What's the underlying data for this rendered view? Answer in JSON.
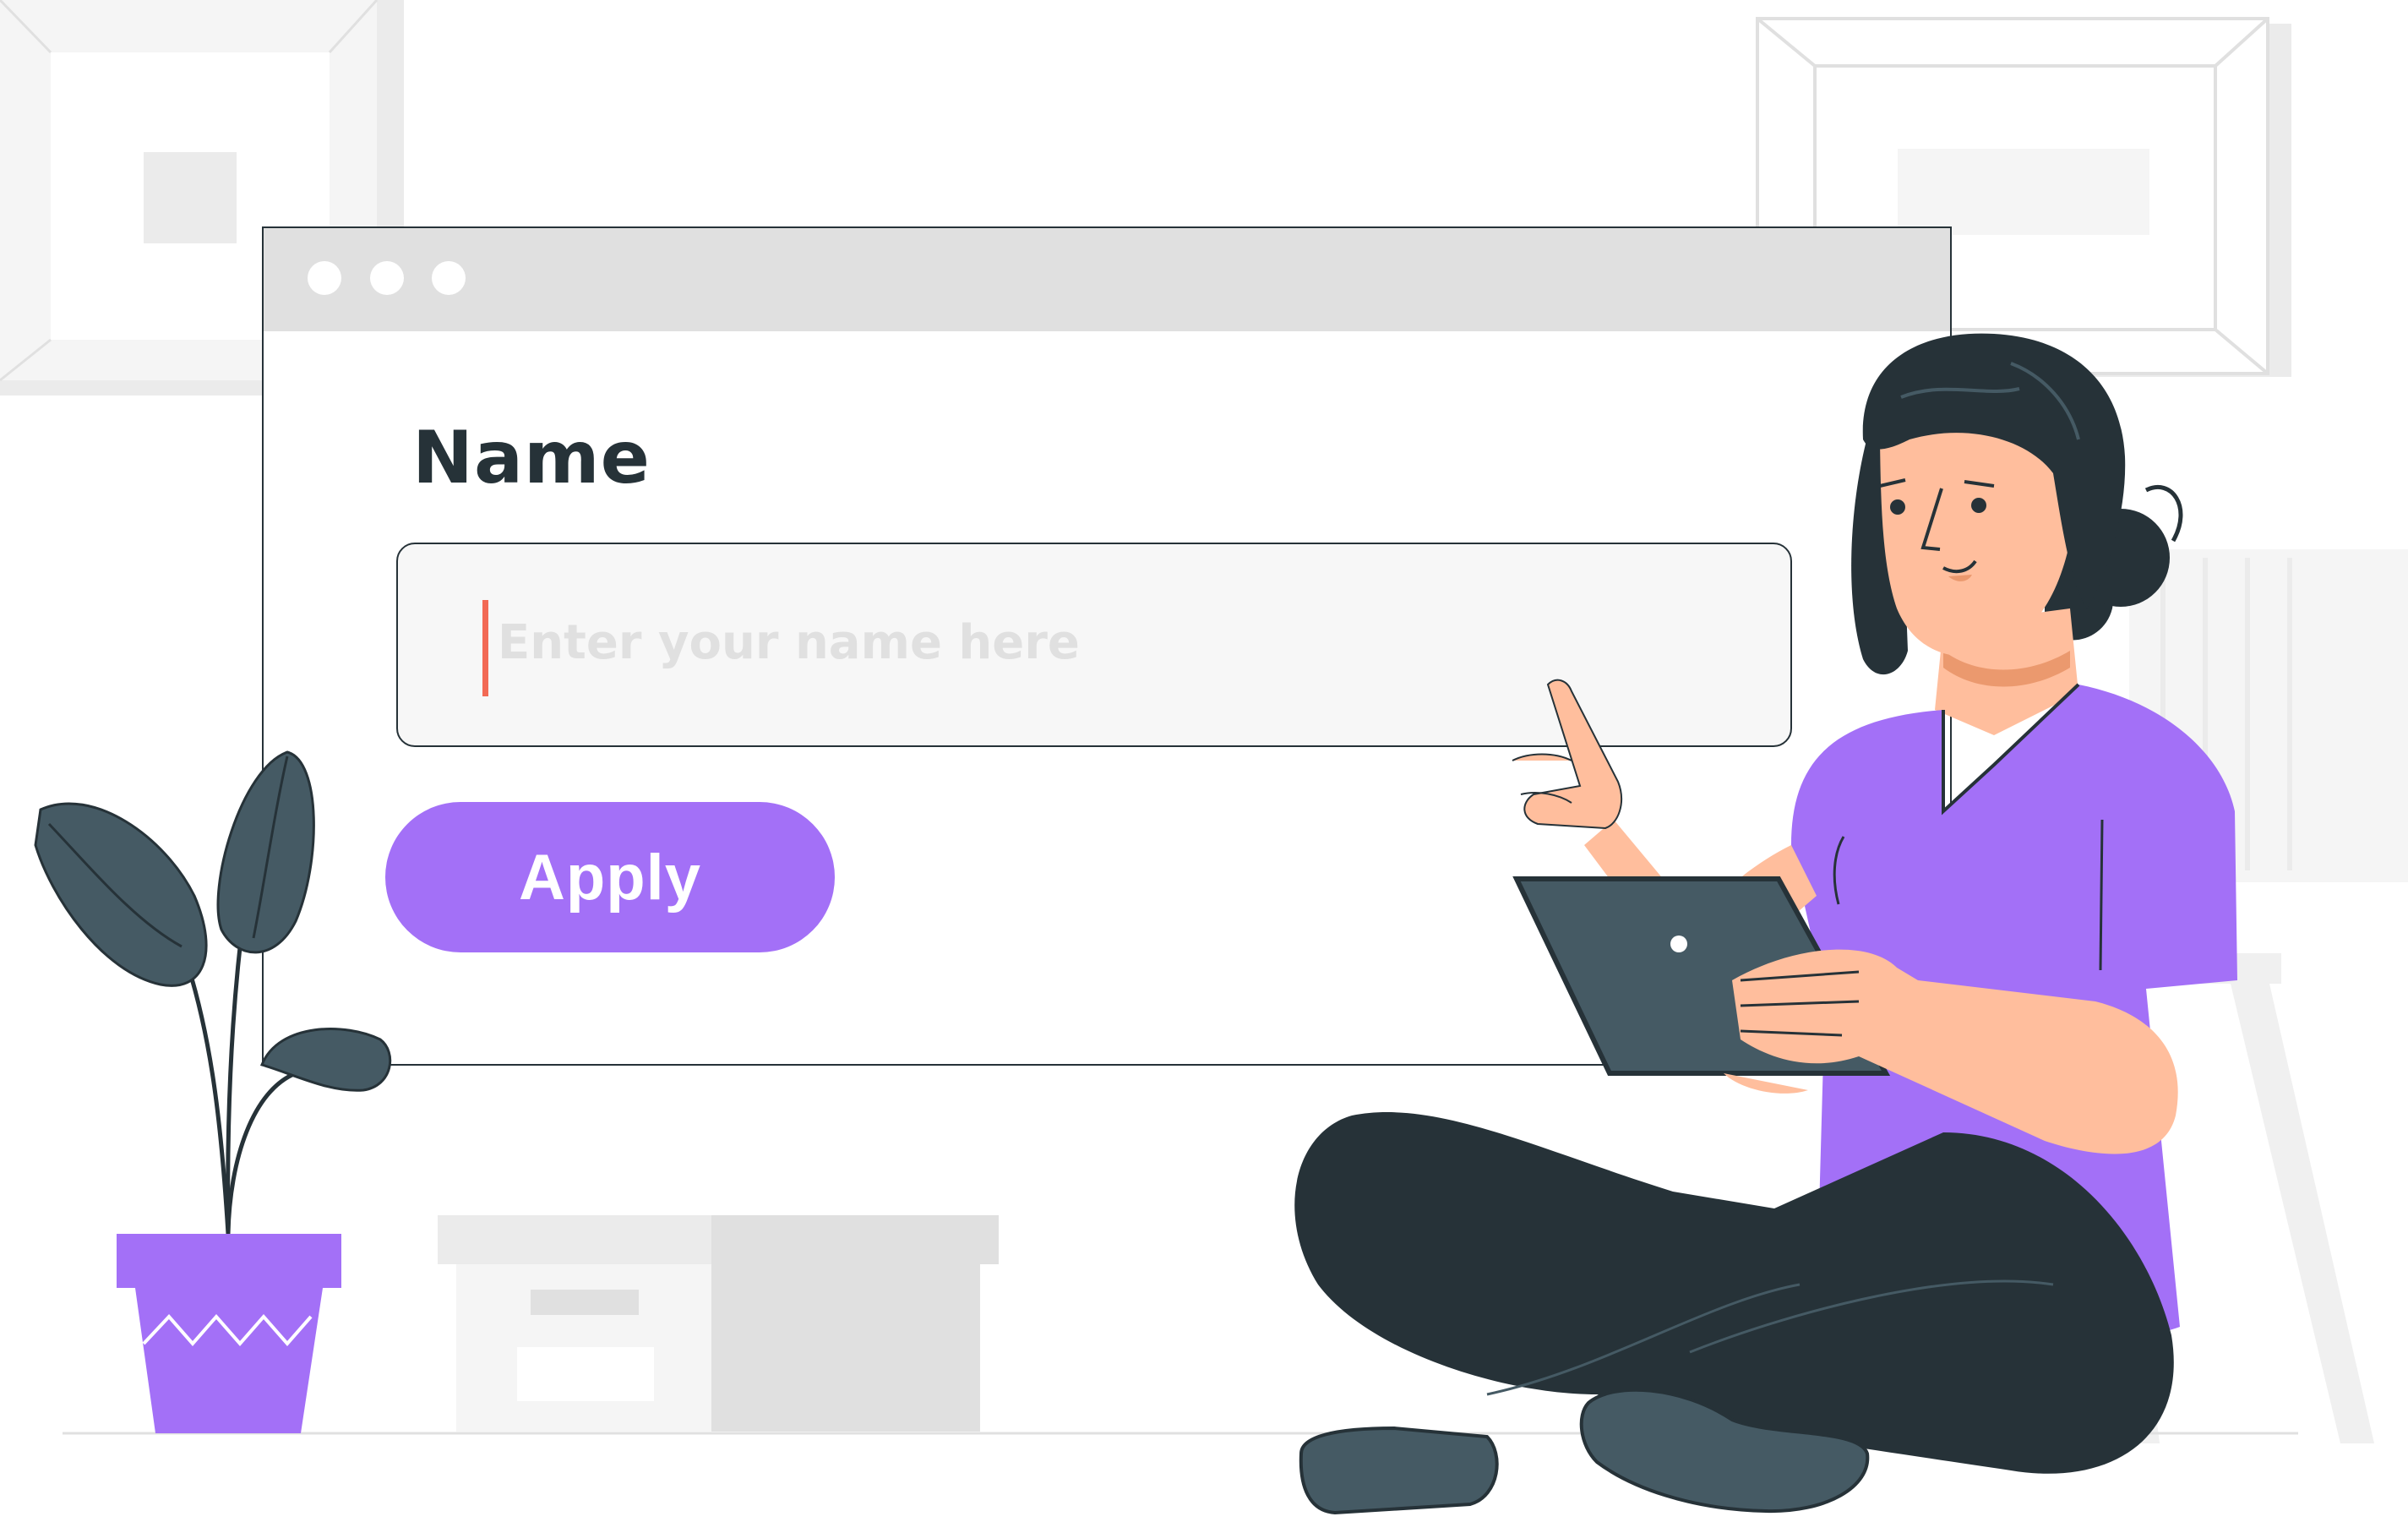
{
  "form": {
    "label": "Name",
    "input_value": "",
    "input_placeholder": "Enter your name here",
    "submit_label": "Apply"
  },
  "colors": {
    "accent": "#a370f7",
    "text": "#263238",
    "caret": "#f26a55",
    "title_bar": "#e0e0e0",
    "placeholder": "#e0e0e0"
  },
  "icons": [
    "window-dot-icon",
    "potted-plant-icon",
    "woman-with-tablet-illustration"
  ]
}
